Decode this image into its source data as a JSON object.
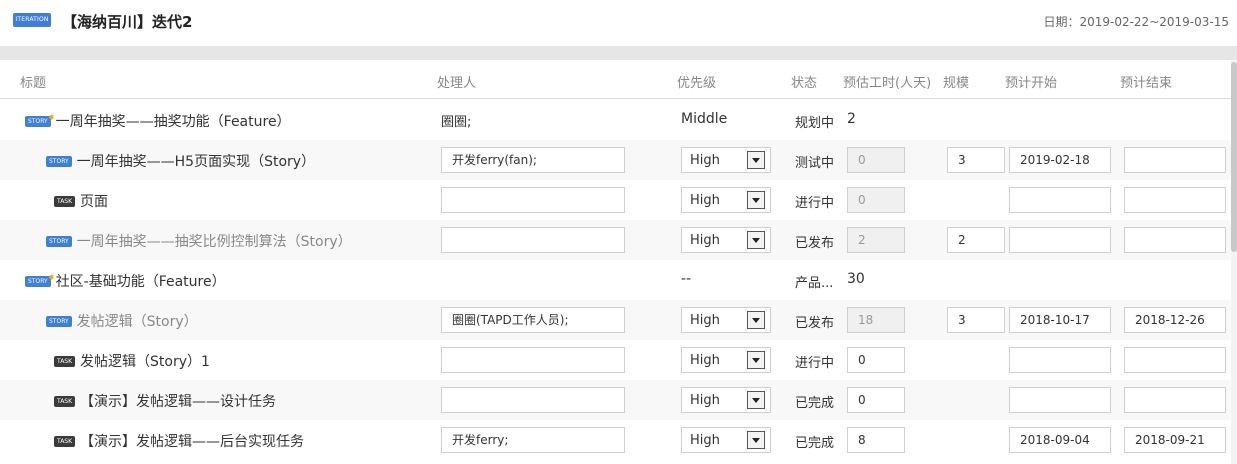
{
  "header": {
    "badge": "ITERATION",
    "title": "【海纳百川】迭代2",
    "date_range": "日期：2019-02-22~2019-03-15"
  },
  "columns": {
    "title": "标题",
    "owner": "处理人",
    "priority": "优先级",
    "status": "状态",
    "estimate": "预估工时(人天)",
    "scale": "规模",
    "start": "预计开始",
    "end": "预计结束"
  },
  "rows": [
    {
      "type": "STORY",
      "title": "一周年抽奖——抽奖功能（Feature）",
      "owner": "圈圈;",
      "priority": "Middle",
      "status": "规划中",
      "estimate": "2"
    },
    {
      "type": "STORY",
      "title": "一周年抽奖——H5页面实现（Story）",
      "owner": "开发ferry(fan);",
      "priority": "High",
      "status": "测试中",
      "estimate": "0",
      "scale": "3",
      "start": "2019-02-18",
      "end": ""
    },
    {
      "type": "TASK",
      "title": "页面",
      "owner": "",
      "priority": "High",
      "status": "进行中",
      "estimate": "0",
      "start": "",
      "end": ""
    },
    {
      "type": "STORY",
      "title": "一周年抽奖——抽奖比例控制算法（Story）",
      "owner": "",
      "priority": "High",
      "status": "已发布",
      "estimate": "2",
      "scale": "2",
      "start": "",
      "end": ""
    },
    {
      "type": "STORY",
      "title": "社区-基础功能（Feature）",
      "priority": "--",
      "status": "产品...",
      "estimate": "30"
    },
    {
      "type": "STORY",
      "title": "发帖逻辑（Story）",
      "owner": "圈圈(TAPD工作人员);",
      "priority": "High",
      "status": "已发布",
      "estimate": "18",
      "scale": "3",
      "start": "2018-10-17",
      "end": "2018-12-26"
    },
    {
      "type": "TASK",
      "title": "发帖逻辑（Story）1",
      "owner": "",
      "priority": "High",
      "status": "进行中",
      "estimate": "0",
      "start": "",
      "end": ""
    },
    {
      "type": "TASK",
      "title": "【演示】发帖逻辑——设计任务",
      "owner": "",
      "priority": "High",
      "status": "已完成",
      "estimate": "0",
      "start": "",
      "end": ""
    },
    {
      "type": "TASK",
      "title": "【演示】发帖逻辑——后台实现任务",
      "owner": "开发ferry;",
      "priority": "High",
      "status": "已完成",
      "estimate": "8",
      "start": "2018-09-04",
      "end": "2018-09-21"
    }
  ],
  "colors": {
    "story_badge": "#3f7fd6",
    "task_badge": "#3b3b3b",
    "star": "#f5a623"
  }
}
